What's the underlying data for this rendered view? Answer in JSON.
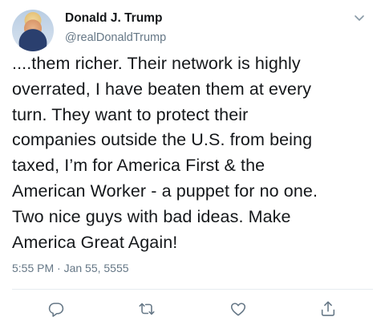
{
  "author": {
    "name": "Donald J. Trump",
    "handle": "@realDonaldTrump"
  },
  "tweet": {
    "text": "....them richer. Their network is highly\noverrated, I have beaten them at every\nturn. They want to protect their\ncompanies outside the U.S. from being\ntaxed, I’m for America First & the\nAmerican Worker - a puppet for no one.\nTwo nice guys with bad ideas. Make\nAmerica Great Again!",
    "timestamp": "5:55 PM · Jan 55, 5555"
  },
  "actions": [
    {
      "icon": "reply-icon"
    },
    {
      "icon": "retweet-icon"
    },
    {
      "icon": "like-icon"
    },
    {
      "icon": "share-icon"
    }
  ],
  "colors": {
    "text": "#14171a",
    "secondary": "#657786",
    "divider": "#e6ecf0"
  }
}
